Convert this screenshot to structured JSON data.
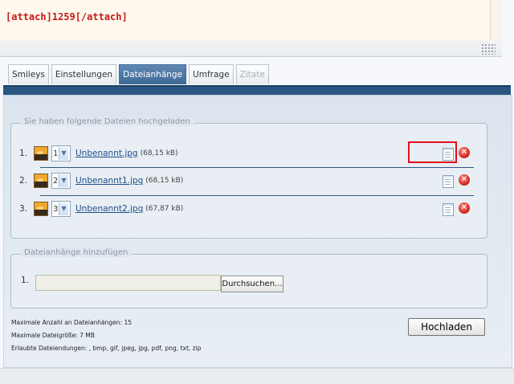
{
  "editor": {
    "content": "[attach]1259[/attach]"
  },
  "tabs": [
    {
      "label": "Smileys"
    },
    {
      "label": "Einstellungen"
    },
    {
      "label": "Dateianhänge"
    },
    {
      "label": "Umfrage"
    },
    {
      "label": "Zitate"
    }
  ],
  "uploaded": {
    "legend": "Sie haben folgende Dateien hochgeladen",
    "files": [
      {
        "num": "1.",
        "order": "1",
        "name": "Unbenannt.jpg",
        "size": "(68,15 kB)"
      },
      {
        "num": "2.",
        "order": "2",
        "name": "Unbenannt1.jpg",
        "size": "(68,15 kB)"
      },
      {
        "num": "3.",
        "order": "3",
        "name": "Unbenannt2.jpg",
        "size": "(67,87 kB)"
      }
    ]
  },
  "add": {
    "legend": "Dateianhänge hinzufügen",
    "num": "1.",
    "browse_label": "Durchsuchen..."
  },
  "info": {
    "max_count": "Maximale Anzahl an Dateianhängen: 15",
    "max_size": "Maximale Dateigröße: 7 MB",
    "extensions": "Erlaubte Dateiendungen: , bmp, gif, jpeg, jpg, pdf, png, txt, zip"
  },
  "upload_button": "Hochladen",
  "icons": {
    "insert": "document-icon",
    "delete": "delete-icon",
    "thumbnail": "image-thumbnail-icon"
  },
  "colors": {
    "highlight": "#e10f18",
    "panel_bar": "#2a5681",
    "active_tab": "#3f6a96"
  }
}
